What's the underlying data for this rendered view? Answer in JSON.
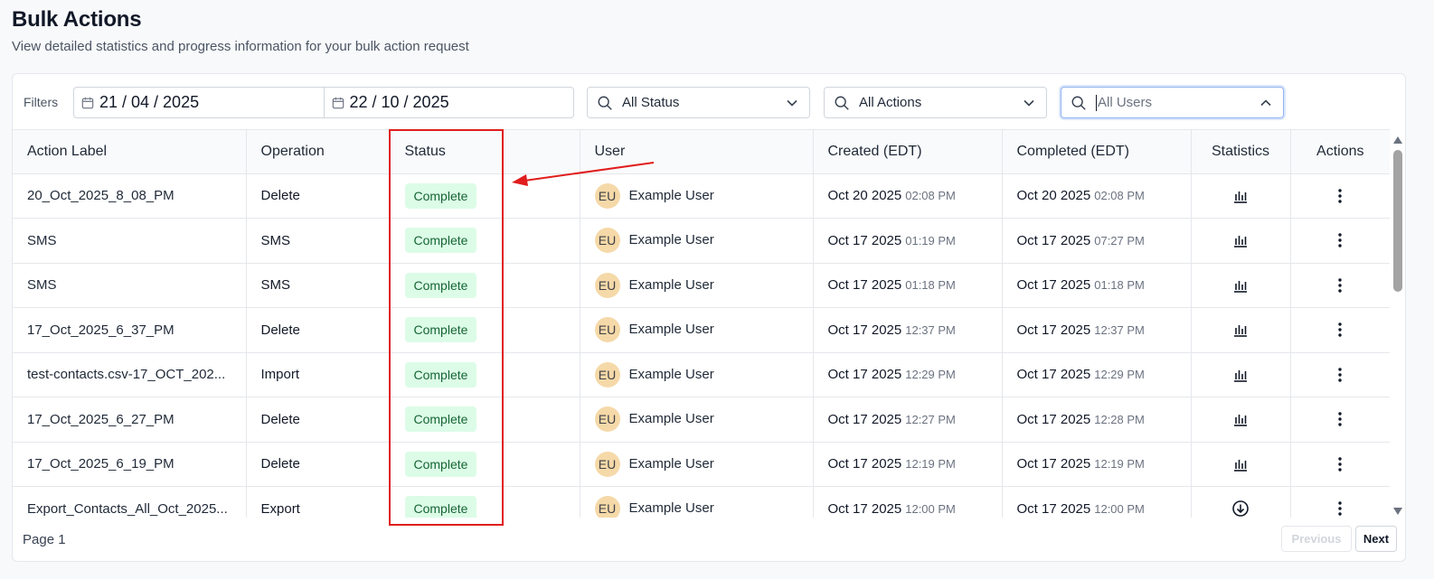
{
  "page": {
    "title": "Bulk Actions",
    "subtitle": "View detailed statistics and progress information for your bulk action request"
  },
  "filters": {
    "label": "Filters",
    "date_from": "21 / 04 / 2025",
    "date_to": "22 / 10 / 2025",
    "status_select": "All Status",
    "actions_select": "All Actions",
    "users_select": "All Users"
  },
  "table": {
    "headers": [
      "Action Label",
      "Operation",
      "Status",
      "User",
      "Created (EDT)",
      "Completed (EDT)",
      "Statistics",
      "Actions"
    ],
    "rows": [
      {
        "label": "20_Oct_2025_8_08_PM",
        "operation": "Delete",
        "status": "Complete",
        "user_initials": "EU",
        "user": "Example User",
        "created_date": "Oct 20 2025",
        "created_time": "02:08 PM",
        "completed_date": "Oct 20 2025",
        "completed_time": "02:08 PM",
        "stat_icon": "bar-chart-icon"
      },
      {
        "label": "SMS",
        "operation": "SMS",
        "status": "Complete",
        "user_initials": "EU",
        "user": "Example User",
        "created_date": "Oct 17 2025",
        "created_time": "01:19 PM",
        "completed_date": "Oct 17 2025",
        "completed_time": "07:27 PM",
        "stat_icon": "bar-chart-icon"
      },
      {
        "label": "SMS",
        "operation": "SMS",
        "status": "Complete",
        "user_initials": "EU",
        "user": "Example User",
        "created_date": "Oct 17 2025",
        "created_time": "01:18 PM",
        "completed_date": "Oct 17 2025",
        "completed_time": "01:18 PM",
        "stat_icon": "bar-chart-icon"
      },
      {
        "label": "17_Oct_2025_6_37_PM",
        "operation": "Delete",
        "status": "Complete",
        "user_initials": "EU",
        "user": "Example User",
        "created_date": "Oct 17 2025",
        "created_time": "12:37 PM",
        "completed_date": "Oct 17 2025",
        "completed_time": "12:37 PM",
        "stat_icon": "bar-chart-icon"
      },
      {
        "label": "test-contacts.csv-17_OCT_202...",
        "operation": "Import",
        "status": "Complete",
        "user_initials": "EU",
        "user": "Example User",
        "created_date": "Oct 17 2025",
        "created_time": "12:29 PM",
        "completed_date": "Oct 17 2025",
        "completed_time": "12:29 PM",
        "stat_icon": "bar-chart-icon"
      },
      {
        "label": "17_Oct_2025_6_27_PM",
        "operation": "Delete",
        "status": "Complete",
        "user_initials": "EU",
        "user": "Example User",
        "created_date": "Oct 17 2025",
        "created_time": "12:27 PM",
        "completed_date": "Oct 17 2025",
        "completed_time": "12:28 PM",
        "stat_icon": "bar-chart-icon"
      },
      {
        "label": "17_Oct_2025_6_19_PM",
        "operation": "Delete",
        "status": "Complete",
        "user_initials": "EU",
        "user": "Example User",
        "created_date": "Oct 17 2025",
        "created_time": "12:19 PM",
        "completed_date": "Oct 17 2025",
        "completed_time": "12:19 PM",
        "stat_icon": "bar-chart-icon"
      },
      {
        "label": "Export_Contacts_All_Oct_2025...",
        "operation": "Export",
        "status": "Complete",
        "user_initials": "EU",
        "user": "Example User",
        "created_date": "Oct 17 2025",
        "created_time": "12:00 PM",
        "completed_date": "Oct 17 2025",
        "completed_time": "12:00 PM",
        "stat_icon": "download-icon"
      }
    ]
  },
  "footer": {
    "page_label": "Page 1",
    "previous_label": "Previous",
    "next_label": "Next"
  },
  "colors": {
    "badge_bg": "#dcfce7",
    "badge_text": "#166534",
    "avatar_bg": "#f5d9a8",
    "annotation_red": "#e11d1d"
  }
}
